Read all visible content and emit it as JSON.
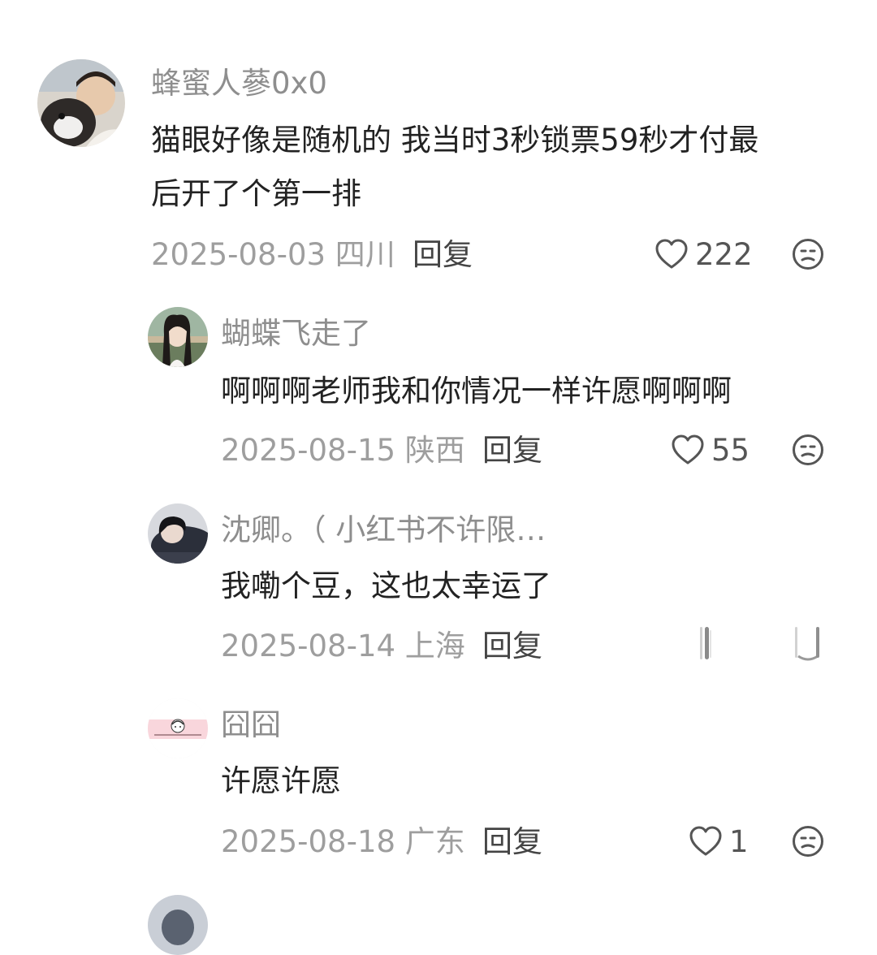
{
  "comments": [
    {
      "username": "蜂蜜人蔘0x0",
      "content": "猫眼好像是随机的 我当时3秒锁票59秒才付最后开了个第一排",
      "content_line1": "猫眼好像是随机的 我当时3秒锁票59秒才付最",
      "content_line2": "后开了个第一排",
      "date": "2025-08-03",
      "location": "四川",
      "reply_label": "回复",
      "likes": "222"
    },
    {
      "username": "蝴蝶飞走了",
      "content": "啊啊啊老师我和你情况一样许愿啊啊啊",
      "date": "2025-08-15",
      "location": "陕西",
      "reply_label": "回复",
      "likes": "55"
    },
    {
      "username": "沈卿。（ 小红书不许限…",
      "content": "我嘞个豆，这也太幸运了",
      "date": "2025-08-14",
      "location": "上海",
      "reply_label": "回复",
      "likes": ""
    },
    {
      "username": "囧囧",
      "content": "许愿许愿",
      "date": "2025-08-18",
      "location": "广东",
      "reply_label": "回复",
      "likes": "1"
    }
  ],
  "icons": {
    "like": "heart-outline-icon",
    "dislike": "sad-face-icon"
  },
  "colors": {
    "username": "#8e8e8e",
    "meta": "#9e9e9e",
    "text": "#222222",
    "icon": "#555555"
  }
}
